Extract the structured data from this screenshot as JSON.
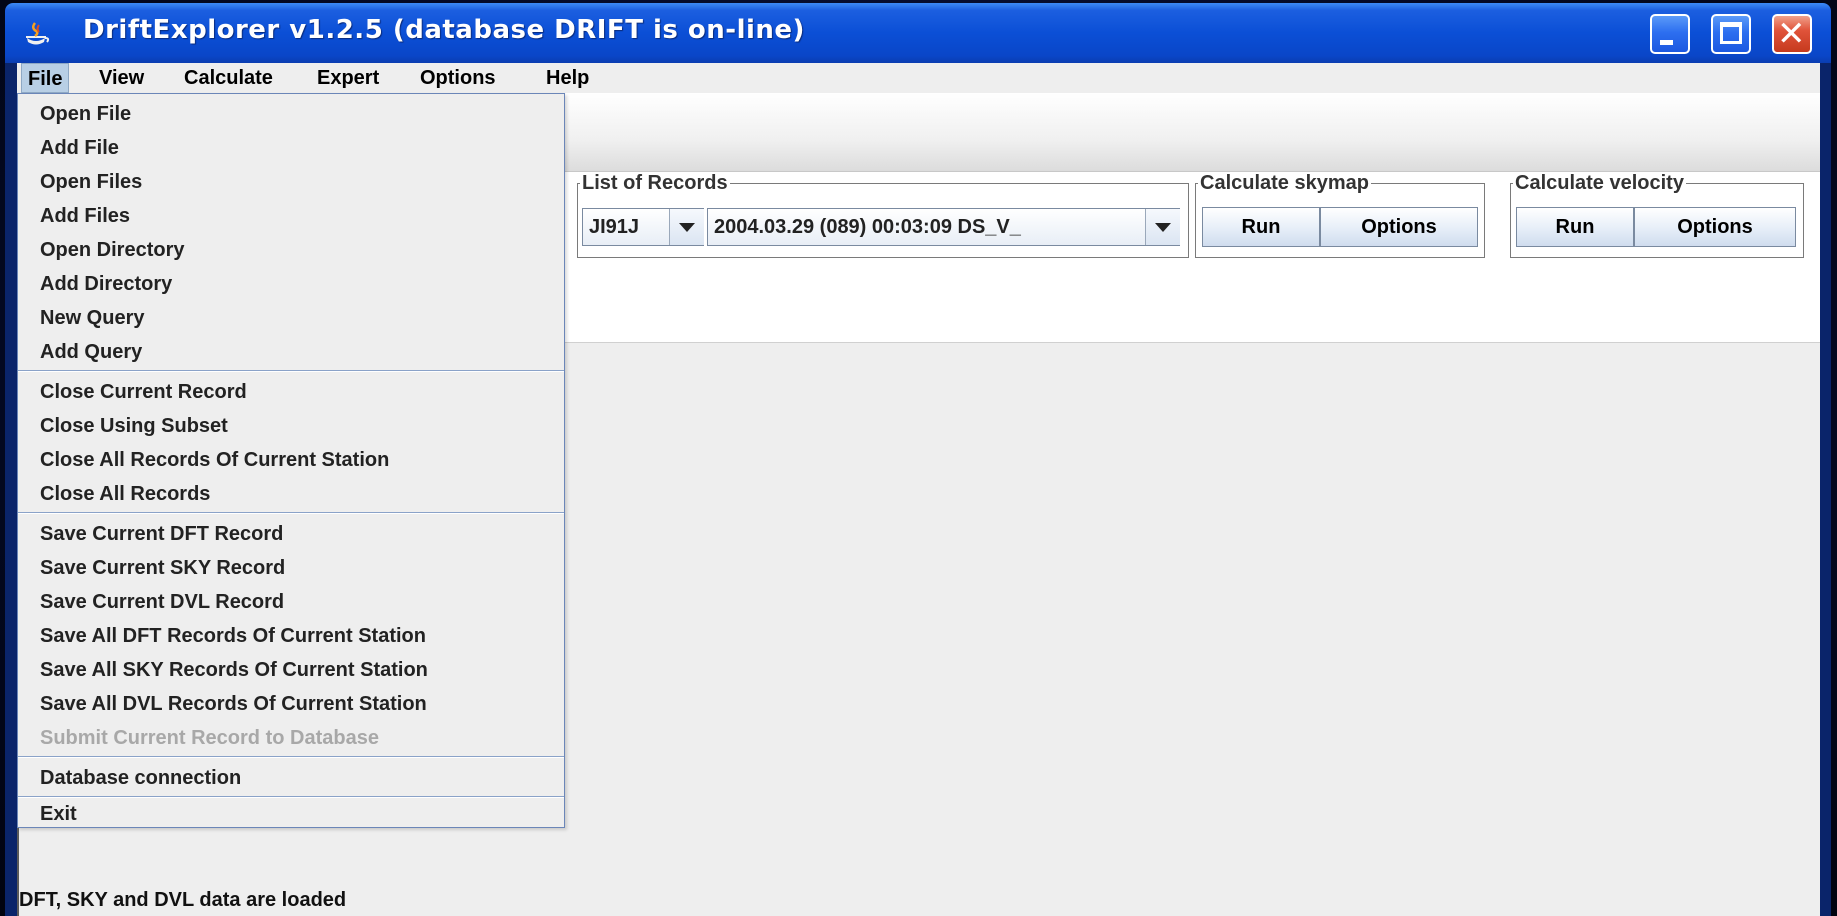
{
  "window": {
    "title": "DriftExplorer v1.2.5 (database DRIFT is on-line)",
    "controls": {
      "minimize": "minimize-icon",
      "maximize": "maximize-icon",
      "close": "close-icon"
    }
  },
  "menubar": {
    "items": [
      {
        "label": "File"
      },
      {
        "label": "View"
      },
      {
        "label": "Calculate"
      },
      {
        "label": "Expert"
      },
      {
        "label": "Options"
      },
      {
        "label": "Help"
      }
    ]
  },
  "file_menu": {
    "items": [
      {
        "label": "Open File"
      },
      {
        "label": "Add File"
      },
      {
        "label": "Open Files"
      },
      {
        "label": "Add Files"
      },
      {
        "label": "Open Directory"
      },
      {
        "label": "Add Directory"
      },
      {
        "label": "New Query"
      },
      {
        "label": "Add Query"
      },
      {
        "label": "Close Current Record"
      },
      {
        "label": "Close Using Subset"
      },
      {
        "label": "Close All Records Of Current Station"
      },
      {
        "label": "Close All Records"
      },
      {
        "label": "Save Current DFT Record"
      },
      {
        "label": "Save Current SKY Record"
      },
      {
        "label": "Save Current DVL Record"
      },
      {
        "label": "Save All DFT Records Of Current Station"
      },
      {
        "label": "Save All SKY Records Of Current Station"
      },
      {
        "label": "Save All DVL Records Of Current Station"
      },
      {
        "label": "Submit Current Record to Database",
        "disabled": true
      },
      {
        "label": "Database connection"
      },
      {
        "label": "Exit"
      }
    ]
  },
  "records_panel": {
    "title": "List of Records",
    "station": "JI91J",
    "record": "2004.03.29 (089) 00:03:09 DS_V_"
  },
  "skymap_panel": {
    "title": "Calculate skymap",
    "run": "Run",
    "options": "Options"
  },
  "velocity_panel": {
    "title": "Calculate velocity",
    "run": "Run",
    "options": "Options"
  },
  "status": {
    "text": "DFT, SKY and DVL data are loaded"
  }
}
